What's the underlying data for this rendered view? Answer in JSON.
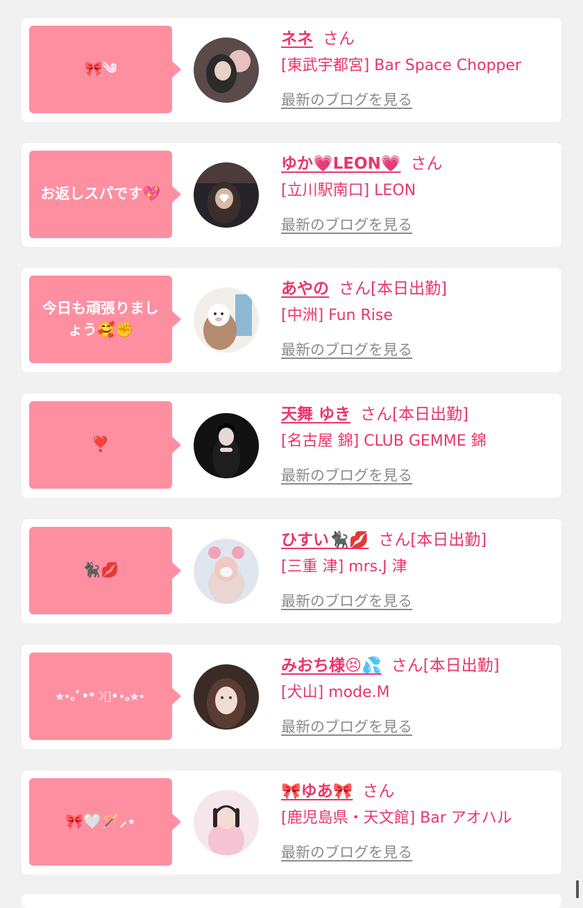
{
  "cards": [
    {
      "message": "🎀༄",
      "name": "ネネ",
      "san": "さん",
      "shop": "[東武宇都宮] Bar Space Chopper",
      "blog_link": "最新のブログを見る",
      "avatar_colors": [
        "#5a4a48",
        "#e7c1bf",
        "#2b2b2b"
      ]
    },
    {
      "message": "お返しスパです💖",
      "name": "ゆか💗LEON💗",
      "san": "さん",
      "shop": "[立川駅南口] LEON",
      "blog_link": "最新のブログを見る",
      "avatar_colors": [
        "#26232a",
        "#d7b9a5",
        "#4b3b3a"
      ]
    },
    {
      "message": "今日も頑張りましょう🥰✊",
      "name": "あやの",
      "san": "さん[本日出勤]",
      "shop": "[中洲] Fun Rise",
      "blog_link": "最新のブログを見る",
      "avatar_colors": [
        "#f2eeea",
        "#e9d4c4",
        "#8fb7d6"
      ]
    },
    {
      "message": "❣️",
      "name": "天舞 ゆき",
      "san": "さん[本日出勤]",
      "shop": "[名古屋 錦] CLUB GEMME 錦",
      "blog_link": "最新のブログを見る",
      "avatar_colors": [
        "#121212",
        "#e8d8d2",
        "#1e1e1e"
      ]
    },
    {
      "message": "🐈‍⬛💋",
      "name": "ひすい🐈‍⬛💋",
      "san": "さん[本日出勤]",
      "shop": "[三重 津] mrs.J 津",
      "blog_link": "最新のブログを見る",
      "avatar_colors": [
        "#dfe6ef",
        "#f3a2b6",
        "#e9d6d3"
      ]
    },
    {
      "message": "⭐︎⋆｡ﾟ•*☽ﾟ•⋆｡⭐︎⋆",
      "name": "みおち様😣💦",
      "san": "さん[本日出勤]",
      "shop": "[犬山] mode.M",
      "blog_link": "最新のブログを見る",
      "avatar_colors": [
        "#5b3c32",
        "#f1dcd4",
        "#3b2b25"
      ]
    },
    {
      "message": "🎀🤍🪄⸝⋆",
      "name": "🎀ゆあ🎀",
      "san": "さん",
      "shop": "[鹿児島県・天文館] Bar アオハル",
      "blog_link": "最新のブログを見る",
      "avatar_colors": [
        "#f4e6ea",
        "#f6c3d2",
        "#2e2426"
      ]
    }
  ],
  "colors": {
    "bubble": "#fd8fa1",
    "name": "#e8356b",
    "link_gray": "#8a8a8a",
    "background": "#f1f1f1"
  }
}
